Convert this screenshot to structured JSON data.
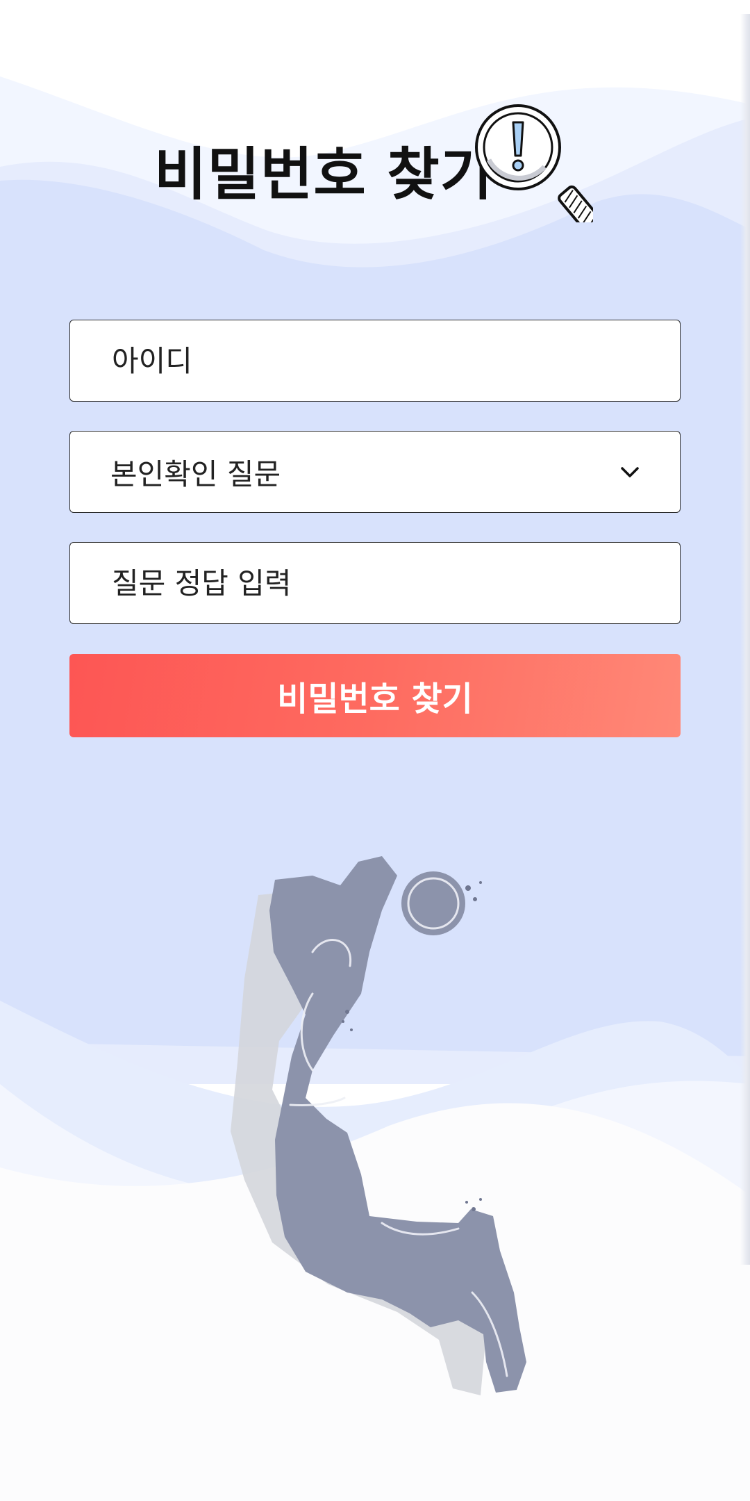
{
  "page": {
    "title": "비밀번호 찾기"
  },
  "form": {
    "id_placeholder": "아이디",
    "question_select": {
      "selected": "본인확인 질문",
      "icon": "chevron-down-icon"
    },
    "answer_placeholder": "질문 정답 입력",
    "submit_label": "비밀번호 찾기"
  },
  "icons": {
    "title_icon": "magnifier-exclamation-icon",
    "illustration": "basketball-player-illustration"
  },
  "colors": {
    "background_blue": "#d8e2fc",
    "light_blue": "#eef3fe",
    "button_start": "#fd5654",
    "button_end": "#ff8877",
    "exclamation": "#a9d0f5",
    "player": "#8c93ab"
  }
}
